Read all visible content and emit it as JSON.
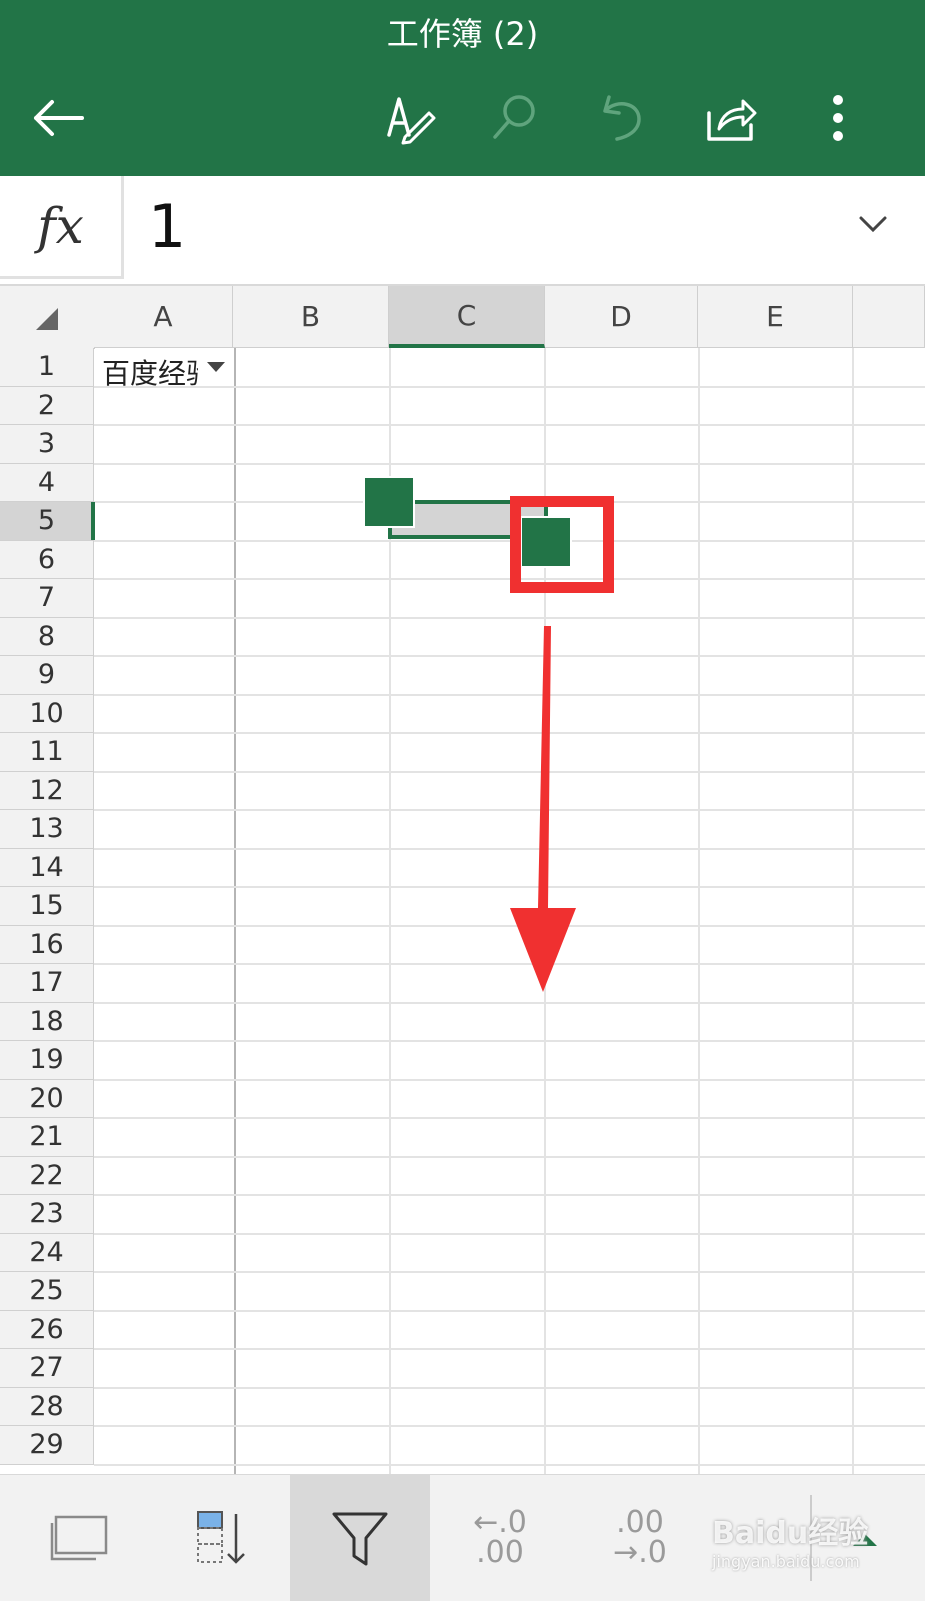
{
  "app": {
    "title": "工作簿 (2)",
    "accent": "#227447"
  },
  "toolbar": {
    "back_icon": "arrow-left-icon",
    "edit_icon": "pen-edit-icon",
    "search_icon": "search-icon",
    "undo_icon": "undo-icon",
    "share_icon": "share-icon",
    "more_icon": "more-vertical-icon"
  },
  "formula_bar": {
    "fx_label": "fx",
    "value": "1"
  },
  "grid": {
    "columns": [
      "A",
      "B",
      "C",
      "D",
      "E"
    ],
    "selected_column": "C",
    "rows": [
      "1",
      "2",
      "3",
      "4",
      "5",
      "6",
      "7",
      "8",
      "9",
      "10",
      "11",
      "12",
      "13",
      "14",
      "15",
      "16",
      "17",
      "18",
      "19",
      "20",
      "21",
      "22",
      "23",
      "24",
      "25",
      "26",
      "27",
      "28",
      "29"
    ],
    "selected_row": "5",
    "cell_a1": "百度经验"
  },
  "annotation": {
    "color": "#f03030"
  },
  "bottom_toolbar": {
    "items": [
      "slides-icon",
      "sort-icon",
      "filter-icon",
      "decrease-decimal-icon",
      "increase-decimal-icon",
      "more-tools-icon"
    ],
    "active": "filter-icon",
    "decrease_top": "←.0",
    "decrease_bottom": ".00",
    "increase_top": ".00",
    "increase_bottom": "→.0"
  },
  "watermark": {
    "logo": "Baidu经验",
    "url": "jingyan.baidu.com"
  }
}
